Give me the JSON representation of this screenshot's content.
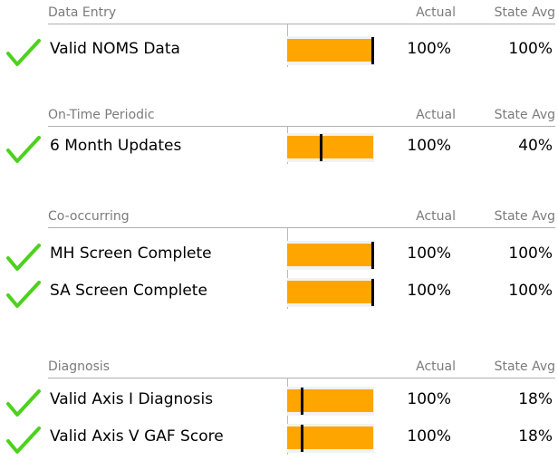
{
  "colors": {
    "bar": "#ffa500",
    "check": "#4cd21c",
    "marker": "#000000"
  },
  "sections": [
    {
      "title": "Data Entry",
      "actual_header": "Actual",
      "state_header": "State Avg",
      "rows": [
        {
          "label": "Valid NOMS Data",
          "icon": "check-icon",
          "actual": "100%",
          "state_avg": "100%",
          "state_avg_fraction": 1.0
        }
      ]
    },
    {
      "title": "On-Time Periodic",
      "actual_header": "Actual",
      "state_header": "State Avg",
      "rows": [
        {
          "label": "6 Month Updates",
          "icon": "check-icon",
          "actual": "100%",
          "state_avg": "40%",
          "state_avg_fraction": 0.4
        }
      ]
    },
    {
      "title": "Co-occurring",
      "actual_header": "Actual",
      "state_header": "State Avg",
      "rows": [
        {
          "label": "MH Screen Complete",
          "icon": "check-icon",
          "actual": "100%",
          "state_avg": "100%",
          "state_avg_fraction": 1.0
        },
        {
          "label": "SA Screen Complete",
          "icon": "check-icon",
          "actual": "100%",
          "state_avg": "100%",
          "state_avg_fraction": 1.0
        }
      ]
    },
    {
      "title": "Diagnosis",
      "actual_header": "Actual",
      "state_header": "State Avg",
      "rows": [
        {
          "label": "Valid Axis I Diagnosis",
          "icon": "check-icon",
          "actual": "100%",
          "state_avg": "18%",
          "state_avg_fraction": 0.18
        },
        {
          "label": "Valid Axis V GAF Score",
          "icon": "check-icon",
          "actual": "100%",
          "state_avg": "18%",
          "state_avg_fraction": 0.18
        }
      ]
    }
  ]
}
